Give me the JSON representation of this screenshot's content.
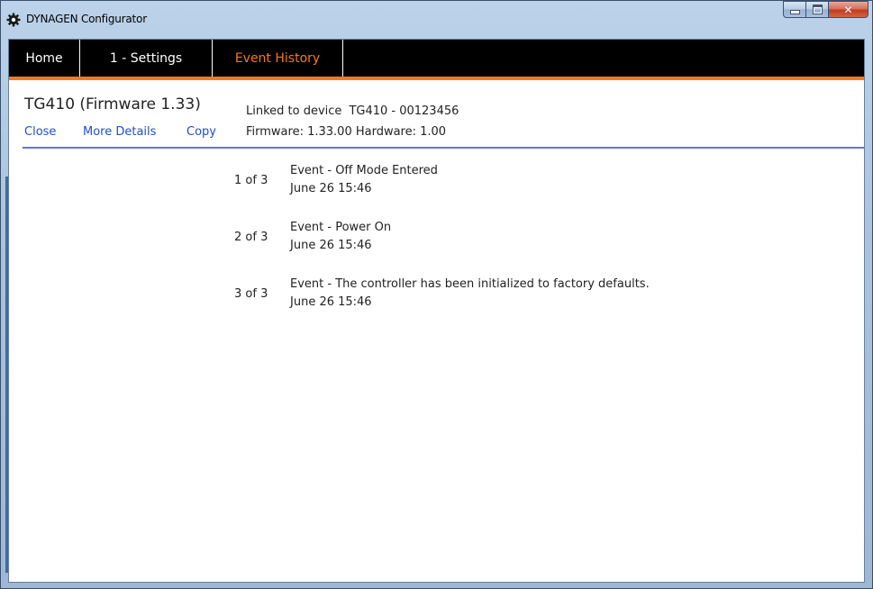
{
  "window": {
    "title": "DYNAGEN Configurator",
    "accent_color": "#f47920",
    "link_color": "#1e4fc4"
  },
  "nav": {
    "tabs": [
      {
        "label": "Home",
        "active": false
      },
      {
        "label": "1 - Settings",
        "active": false
      },
      {
        "label": "Event History",
        "active": true
      }
    ]
  },
  "device": {
    "title": "TG410 (Firmware 1.33)",
    "linked_label": "Linked to device",
    "linked_device": "TG410  - 00123456",
    "firmware_line": "Firmware: 1.33.00 Hardware: 1.00",
    "actions": {
      "close": "Close",
      "more_details": "More Details",
      "copy": "Copy"
    }
  },
  "events": [
    {
      "index": "1 of 3",
      "text": "Event - Off Mode Entered",
      "time": "June 26  15:46"
    },
    {
      "index": "2 of 3",
      "text": "Event - Power On",
      "time": "June 26  15:46"
    },
    {
      "index": "3 of 3",
      "text": "Event - The controller has been initialized to factory defaults.",
      "time": "June 26  15:46"
    }
  ]
}
